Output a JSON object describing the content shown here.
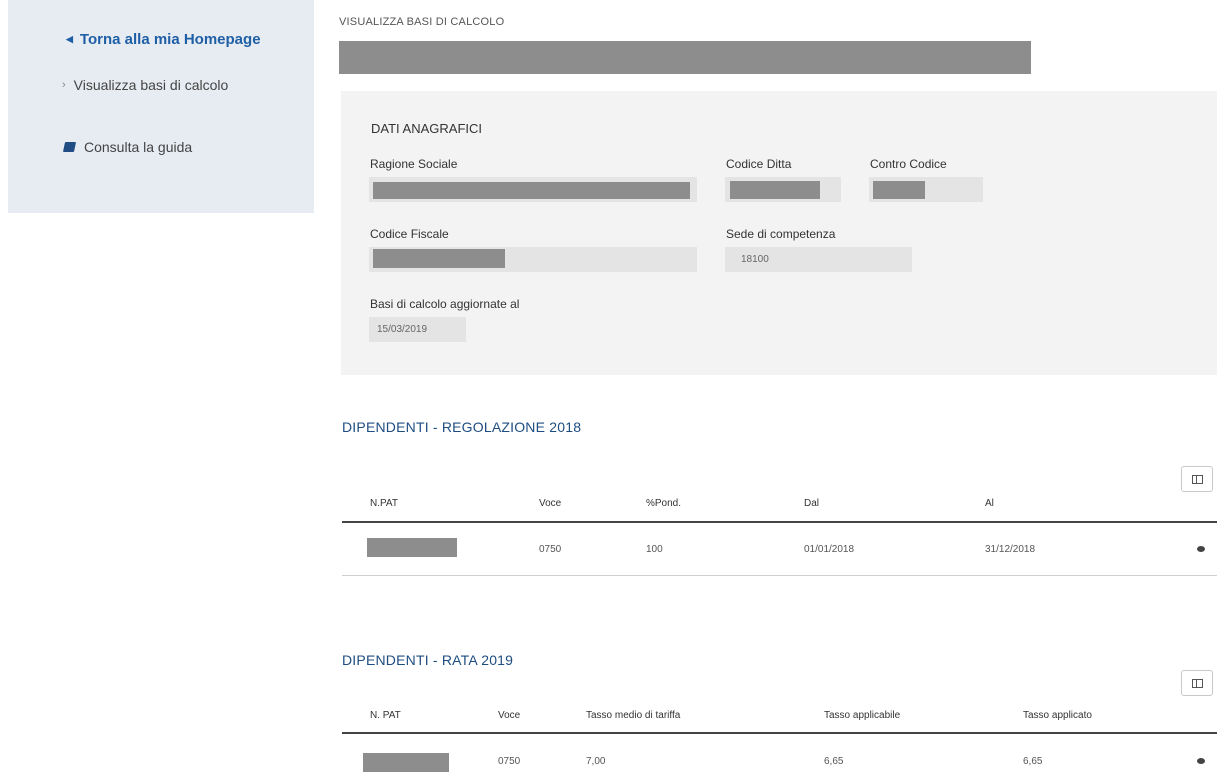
{
  "sidebar": {
    "back_label": "Torna alla mia Homepage",
    "item_label": "Visualizza basi di calcolo",
    "guide_label": "Consulta la guida"
  },
  "page": {
    "title": "VISUALIZZA BASI DI CALCOLO"
  },
  "anagrafica": {
    "heading": "DATI ANAGRAFICI",
    "ragione_sociale_label": "Ragione Sociale",
    "codice_ditta_label": "Codice Ditta",
    "contro_codice_label": "Contro Codice",
    "codice_fiscale_label": "Codice Fiscale",
    "sede_label": "Sede di competenza",
    "sede_value": "18100",
    "basi_label": "Basi di calcolo aggiornate al",
    "basi_value": "15/03/2019"
  },
  "regolazione": {
    "title": "DIPENDENTI - REGOLAZIONE 2018",
    "headers": [
      "N.PAT",
      "Voce",
      "%Pond.",
      "Dal",
      "Al"
    ],
    "rows": [
      {
        "voce": "0750",
        "pond": "100",
        "dal": "01/01/2018",
        "al": "31/12/2018"
      }
    ]
  },
  "rata": {
    "title": "DIPENDENTI - RATA 2019",
    "headers": [
      "N. PAT",
      "Voce",
      "Tasso medio di tariffa",
      "Tasso applicabile",
      "Tasso applicato"
    ],
    "rows": [
      {
        "voce": "0750",
        "tasso_medio": "7,00",
        "applicabile": "6,65",
        "applicato": "6,65"
      }
    ]
  },
  "colors": {
    "accent": "#1f5fa6",
    "section": "#1e4d80",
    "redaction": "#8d8d8d"
  }
}
